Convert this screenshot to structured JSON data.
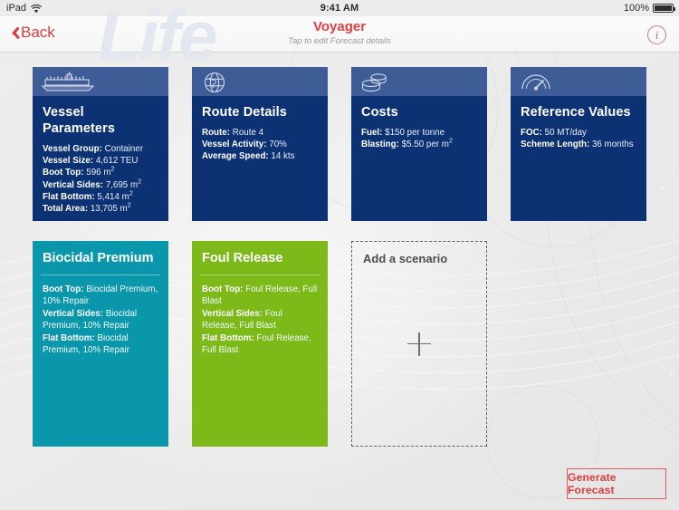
{
  "status_bar": {
    "device": "iPad",
    "wifi_icon": "wifi-icon",
    "time": "9:41 AM",
    "battery_percent": "100%",
    "battery_icon": "battery-icon"
  },
  "nav": {
    "back_label": "Back",
    "back_icon": "chevron-left-icon",
    "watermark": "Life",
    "title": "Voyager",
    "subtitle": "Tap to edit Forecast details",
    "info_icon": "info-circle-icon",
    "info_label": "i"
  },
  "colors": {
    "card_blue": "#0d3274",
    "card_blue_band": "#3e5d96",
    "teal": "#0b97ab",
    "green": "#7cb919",
    "accent_red": "#e03c3c",
    "background": "#ececec"
  },
  "info_cards": [
    {
      "icon": "ship-icon",
      "title": "Vessel Parameters",
      "rows": [
        {
          "key": "Vessel Group:",
          "value": " Container"
        },
        {
          "key": "Vessel Size:",
          "value": " 4,612 TEU"
        },
        {
          "key": "Boot Top:",
          "value": " 596 m",
          "sup": "2"
        },
        {
          "key": "Vertical Sides:",
          "value": " 7,695 m",
          "sup": "2"
        },
        {
          "key": "Flat Bottom:",
          "value": " 5,414 m",
          "sup": "2"
        },
        {
          "key": "Total Area:",
          "value": " 13,705 m",
          "sup": "2"
        }
      ]
    },
    {
      "icon": "globe-icon",
      "title": "Route Details",
      "rows": [
        {
          "key": "Route:",
          "value": " Route 4"
        },
        {
          "key": "Vessel Activity:",
          "value": " 70%"
        },
        {
          "key": "Average Speed:",
          "value": " 14 kts"
        }
      ]
    },
    {
      "icon": "coins-icon",
      "title": "Costs",
      "rows": [
        {
          "key": "Fuel:",
          "value": " $150 per tonne"
        },
        {
          "key": "Blasting:",
          "value": " $5.50 per m",
          "sup": "2"
        }
      ]
    },
    {
      "icon": "gauge-icon",
      "title": "Reference Values",
      "rows": [
        {
          "key": "FOC:",
          "value": " 50 MT/day"
        },
        {
          "key": "Scheme Length:",
          "value": " 36 months"
        }
      ]
    }
  ],
  "scenario_cards": [
    {
      "title": "Biocidal Premium",
      "color": "#0b97ab",
      "rows": [
        {
          "key": "Boot Top:",
          "value": " Biocidal Premium, 10% Repair"
        },
        {
          "key": "Vertical Sides:",
          "value": " Biocidal Premium, 10% Repair"
        },
        {
          "key": "Flat Bottom:",
          "value": " Biocidal Premium, 10% Repair"
        }
      ]
    },
    {
      "title": "Foul Release",
      "color": "#7cb919",
      "rows": [
        {
          "key": "Boot Top:",
          "value": " Foul Release, Full Blast"
        },
        {
          "key": "Vertical Sides:",
          "value": " Foul Release, Full Blast"
        },
        {
          "key": "Flat Bottom:",
          "value": " Foul Release, Full Blast"
        }
      ]
    }
  ],
  "add_scenario": {
    "title": "Add a scenario",
    "plus_icon": "plus-icon"
  },
  "actions": {
    "generate_forecast_label": "Generate Forecast"
  }
}
